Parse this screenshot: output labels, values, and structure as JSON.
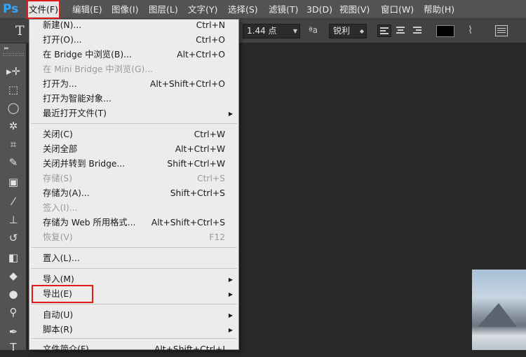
{
  "app": {
    "logo": "Ps"
  },
  "menubar": {
    "items": [
      "文件(F)",
      "编辑(E)",
      "图像(I)",
      "图层(L)",
      "文字(Y)",
      "选择(S)",
      "滤镜(T)",
      "3D(D)",
      "视图(V)",
      "窗口(W)",
      "帮助(H)"
    ]
  },
  "options": {
    "tool_glyph": "T",
    "font_size": "1.44 点",
    "aa_label": "ªa",
    "antialias": "锐利",
    "text_color": "#000000"
  },
  "tools": [
    {
      "name": "move-tool",
      "glyph": "▸✛"
    },
    {
      "name": "marquee-tool",
      "glyph": "⬚"
    },
    {
      "name": "lasso-tool",
      "glyph": "◯"
    },
    {
      "name": "magic-wand-tool",
      "glyph": "✲"
    },
    {
      "name": "crop-tool",
      "glyph": "⌗"
    },
    {
      "name": "eyedropper-tool",
      "glyph": "✎"
    },
    {
      "name": "healing-tool",
      "glyph": "▣"
    },
    {
      "name": "brush-tool",
      "glyph": "⁄"
    },
    {
      "name": "stamp-tool",
      "glyph": "⊥"
    },
    {
      "name": "history-brush-tool",
      "glyph": "↺"
    },
    {
      "name": "eraser-tool",
      "glyph": "◧"
    },
    {
      "name": "paint-bucket-tool",
      "glyph": "◆"
    },
    {
      "name": "blur-tool",
      "glyph": "●"
    },
    {
      "name": "dodge-tool",
      "glyph": "⚲"
    },
    {
      "name": "pen-tool",
      "glyph": "✒"
    },
    {
      "name": "type-tool",
      "glyph": "T"
    }
  ],
  "file_menu": {
    "items": [
      {
        "label": "新建(N)...",
        "shortcut": "Ctrl+N",
        "disabled": false,
        "submenu": false
      },
      {
        "label": "打开(O)...",
        "shortcut": "Ctrl+O",
        "disabled": false,
        "submenu": false
      },
      {
        "label": "在 Bridge 中浏览(B)...",
        "shortcut": "Alt+Ctrl+O",
        "disabled": false,
        "submenu": false
      },
      {
        "label": "在 Mini Bridge 中浏览(G)...",
        "shortcut": "",
        "disabled": true,
        "submenu": false
      },
      {
        "label": "打开为...",
        "shortcut": "Alt+Shift+Ctrl+O",
        "disabled": false,
        "submenu": false
      },
      {
        "label": "打开为智能对象...",
        "shortcut": "",
        "disabled": false,
        "submenu": false
      },
      {
        "label": "最近打开文件(T)",
        "shortcut": "",
        "disabled": false,
        "submenu": true
      },
      {
        "label": "关闭(C)",
        "shortcut": "Ctrl+W",
        "disabled": false,
        "submenu": false
      },
      {
        "label": "关闭全部",
        "shortcut": "Alt+Ctrl+W",
        "disabled": false,
        "submenu": false
      },
      {
        "label": "关闭并转到 Bridge...",
        "shortcut": "Shift+Ctrl+W",
        "disabled": false,
        "submenu": false
      },
      {
        "label": "存储(S)",
        "shortcut": "Ctrl+S",
        "disabled": true,
        "submenu": false
      },
      {
        "label": "存储为(A)...",
        "shortcut": "Shift+Ctrl+S",
        "disabled": false,
        "submenu": false
      },
      {
        "label": "签入(I)...",
        "shortcut": "",
        "disabled": true,
        "submenu": false
      },
      {
        "label": "存储为 Web 所用格式...",
        "shortcut": "Alt+Shift+Ctrl+S",
        "disabled": false,
        "submenu": false
      },
      {
        "label": "恢复(V)",
        "shortcut": "F12",
        "disabled": true,
        "submenu": false
      },
      {
        "label": "置入(L)...",
        "shortcut": "",
        "disabled": false,
        "submenu": false
      },
      {
        "label": "导入(M)",
        "shortcut": "",
        "disabled": false,
        "submenu": true
      },
      {
        "label": "导出(E)",
        "shortcut": "",
        "disabled": false,
        "submenu": true
      },
      {
        "label": "自动(U)",
        "shortcut": "",
        "disabled": false,
        "submenu": true
      },
      {
        "label": "脚本(R)",
        "shortcut": "",
        "disabled": false,
        "submenu": true
      },
      {
        "label": "文件简介(F)...",
        "shortcut": "Alt+Shift+Ctrl+I",
        "disabled": false,
        "submenu": false
      }
    ]
  }
}
